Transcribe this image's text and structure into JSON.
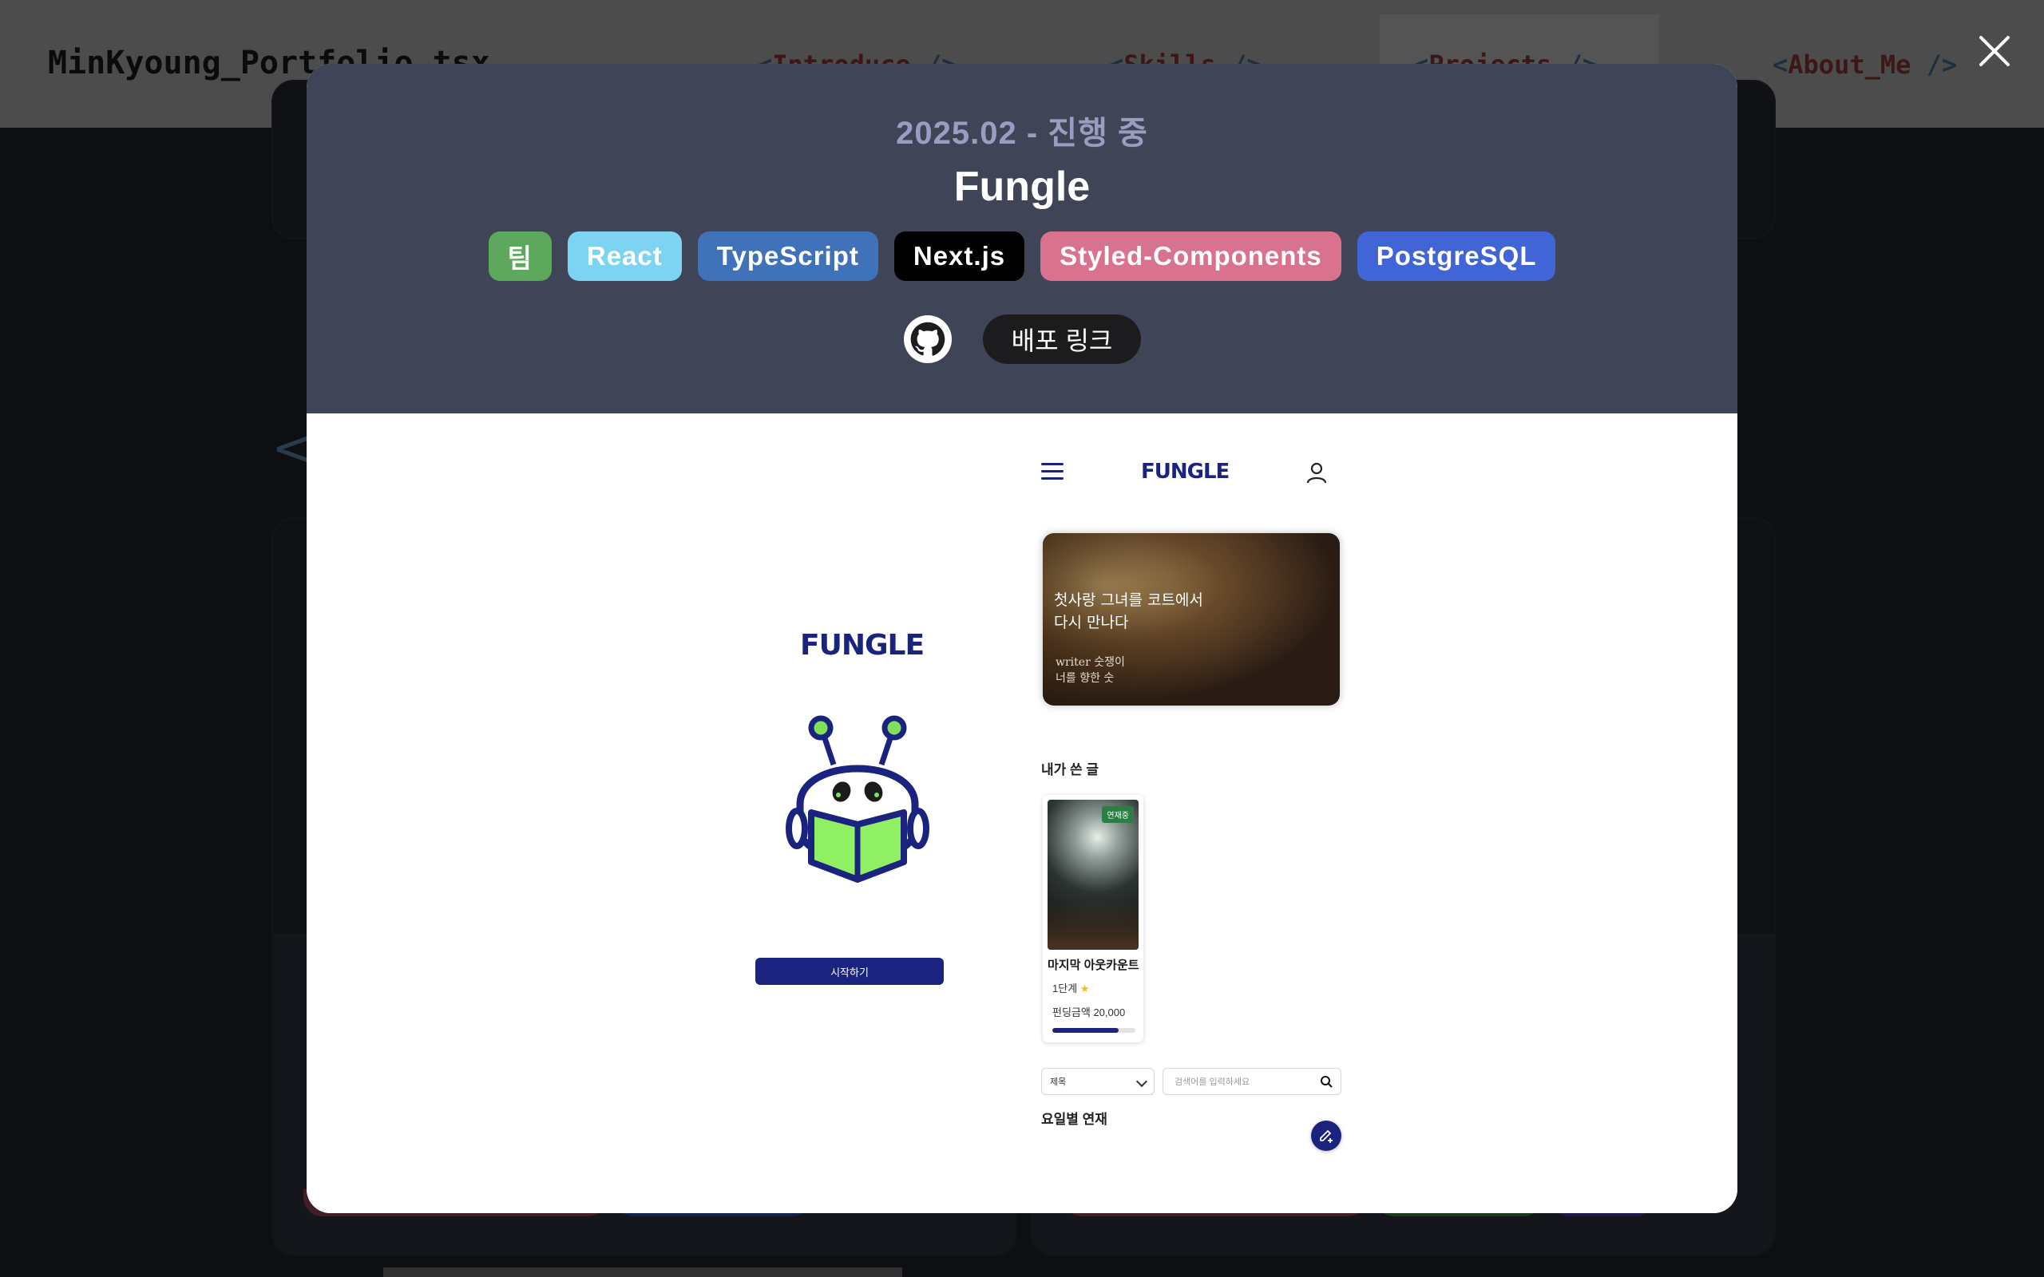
{
  "background": {
    "brand": "MinKyoung_Portfolio.tsx",
    "nav": [
      {
        "open": "<",
        "label": "Introduce",
        "close": "/>"
      },
      {
        "open": "<",
        "label": "Skills",
        "close": "/>"
      },
      {
        "open": "<",
        "label": "Projects",
        "close": "/>"
      },
      {
        "open": "<",
        "label": "About_Me",
        "close": "/>"
      }
    ],
    "prev_arrow": "<"
  },
  "modal": {
    "period": "2025.02 - 진행 중",
    "title": "Fungle",
    "tags": [
      {
        "label": "팀",
        "color": "#5ea85e"
      },
      {
        "label": "React",
        "color": "#7dd3f2"
      },
      {
        "label": "TypeScript",
        "color": "#3f72b8"
      },
      {
        "label": "Next.js",
        "color": "#000000"
      },
      {
        "label": "Styled-Components",
        "color": "#d9728e"
      },
      {
        "label": "PostgreSQL",
        "color": "#4164d6"
      }
    ],
    "github_icon": "github-icon",
    "deploy_label": "배포 링크",
    "close_icon": "close-icon"
  },
  "preview": {
    "left": {
      "logo": "FUNGLE",
      "start_button": "시작하기"
    },
    "right": {
      "logo": "FUNGLE",
      "banner_title": "첫사랑 그녀를 코트에서\n다시 만나다",
      "banner_sub": "writer 숫쟁이\n너를 향한 숫",
      "my_posts_label": "내가 쓴 글",
      "book": {
        "badge": "연재중",
        "title": "마지막 아웃카운트",
        "level": "1단계",
        "level_icon": "star-icon",
        "fund": "펀딩금액 20,000",
        "progress": 0.8
      },
      "filter_value": "제목",
      "search_placeholder": "검색어를 입력하세요",
      "weekly_label": "요일별 연재"
    }
  }
}
